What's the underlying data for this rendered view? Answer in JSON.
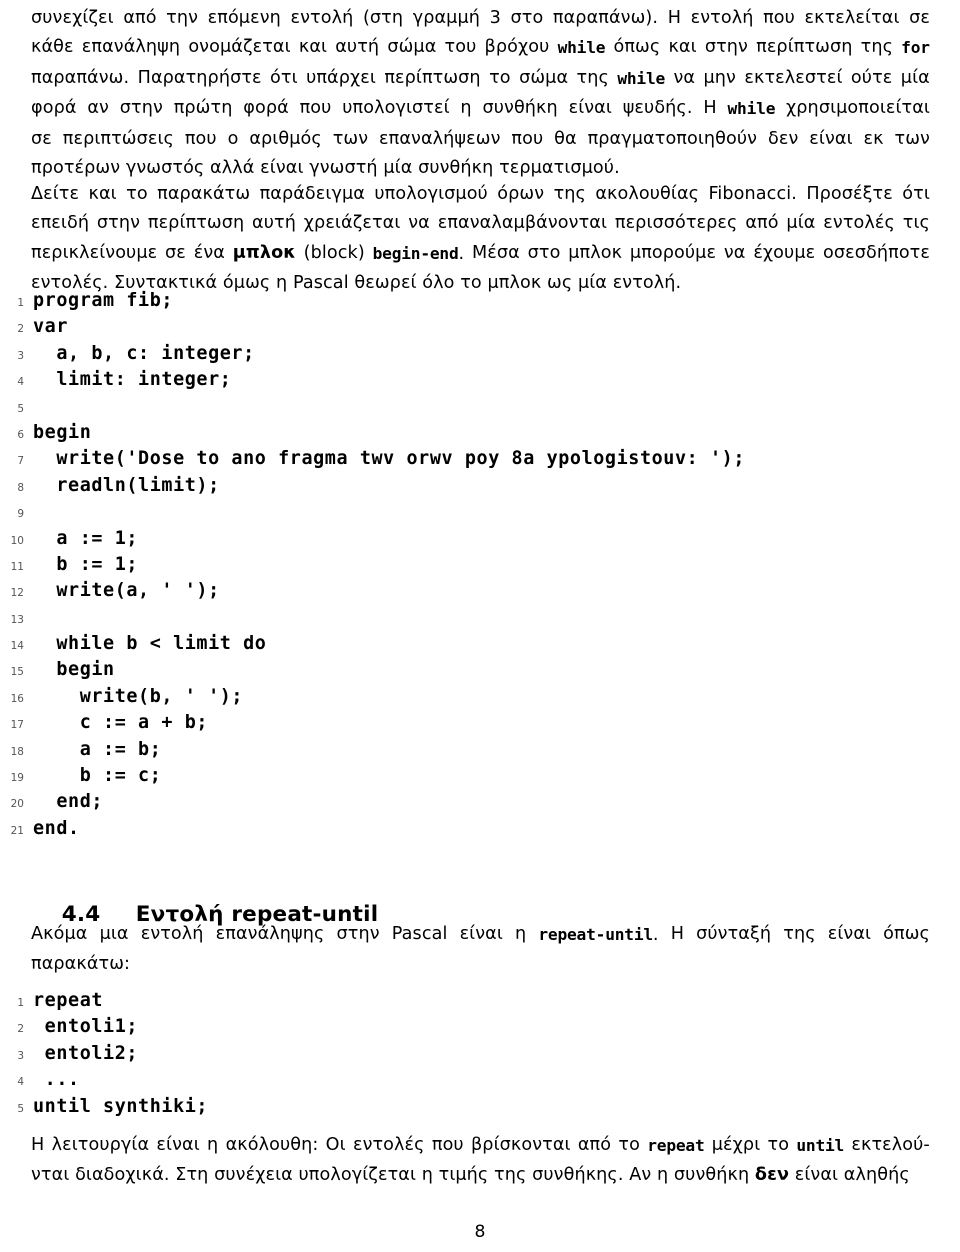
{
  "document": {
    "page_number": "8",
    "language": "el"
  },
  "paragraphs": {
    "p1": {
      "lines": [
        [
          "συνεχίζει από την επόμενη εντολή (στη γραμμή 3 στο παραπάνω). Η εντολή που εκτελείται σε"
        ],
        [
          "κάθε επανάληψη ονομάζεται και αυτή σώμα του βρόχου ",
          "while",
          " όπως και στην περίπτωση της ",
          "for"
        ],
        [
          "παραπάνω. Παρατηρήστε ότι υπάρχει περίπτωση το σώμα της ",
          "while",
          " να μην εκτελεστεί ούτε μία"
        ],
        [
          "φορά αν στην πρώτη φορά που υπολογιστεί η συνθήκη είναι ψευδής. Η ",
          "while",
          " χρησιμοποιείται"
        ],
        [
          "σε περιπτώσεις που ο αριθμός των επαναλήψεων που θα πραγματοποιηθούν δεν είναι εκ των"
        ],
        [
          "προτέρων γνωστός αλλά είναι γνωστή μία συνθήκη τερματισμού."
        ]
      ]
    },
    "p2": {
      "lines": [
        [
          "Δείτε και το παρακάτω παράδειγμα υπολογισμού όρων της ακολουθίας Fibonacci. Προσέξτε ότι"
        ],
        [
          "επειδή στην περίπτωση αυτή χρειάζεται να επαναλαμβάνονται περισσότερες από μία εντολές τις"
        ],
        [
          "περικλείνουμε σε ένα ",
          "μπλοκ",
          " (block) ",
          "begin-end",
          ". Μέσα στο μπλοκ μπορούμε να έχουμε οσεσδήποτε"
        ],
        [
          "εντολές. Συντακτικά όμως η Pascal θεωρεί όλο το μπλοκ ως μία εντολή."
        ]
      ]
    },
    "p3": {
      "lines": [
        [
          "Ακόμα μια εντολή επανάληψης στην Pascal είναι η ",
          "repeat-until",
          ". Η σύνταξή της είναι όπως"
        ],
        [
          "παρακάτω:"
        ]
      ]
    },
    "p4": {
      "lines": [
        [
          "Η λειτουργία είναι η ακόλουθη: Οι εντολές που βρίσκονται από το ",
          "repeat",
          " μέχρι το ",
          "until",
          " εκτελού-"
        ],
        [
          "νται διαδοχικά. Στη συνέχεια υπολογίζεται η τιμής της συνθήκης. Αν η συνθήκη ",
          "δεν",
          " είναι αληθής"
        ]
      ]
    }
  },
  "heading": {
    "number": "4.4",
    "text": "Εντολή repeat-until"
  },
  "listing_fib": {
    "lines": [
      {
        "n": "1",
        "code": "program fib;"
      },
      {
        "n": "2",
        "code": "var"
      },
      {
        "n": "3",
        "code": "  a, b, c: integer;"
      },
      {
        "n": "4",
        "code": "  limit: integer;"
      },
      {
        "n": "5",
        "code": ""
      },
      {
        "n": "6",
        "code": "begin"
      },
      {
        "n": "7",
        "code": "  write('Dose to ano fragma twv orwv poy 8a ypologistouv: ');"
      },
      {
        "n": "8",
        "code": "  readln(limit);"
      },
      {
        "n": "9",
        "code": ""
      },
      {
        "n": "10",
        "code": "  a := 1;"
      },
      {
        "n": "11",
        "code": "  b := 1;"
      },
      {
        "n": "12",
        "code": "  write(a, ' ');"
      },
      {
        "n": "13",
        "code": ""
      },
      {
        "n": "14",
        "code": "  while b < limit do"
      },
      {
        "n": "15",
        "code": "  begin"
      },
      {
        "n": "16",
        "code": "    write(b, ' ');"
      },
      {
        "n": "17",
        "code": "    c := a + b;"
      },
      {
        "n": "18",
        "code": "    a := b;"
      },
      {
        "n": "19",
        "code": "    b := c;"
      },
      {
        "n": "20",
        "code": "  end;"
      },
      {
        "n": "21",
        "code": "end."
      }
    ]
  },
  "listing_repeat": {
    "lines": [
      {
        "n": "1",
        "code": "repeat"
      },
      {
        "n": "2",
        "code": " entoli1;"
      },
      {
        "n": "3",
        "code": " entoli2;"
      },
      {
        "n": "4",
        "code": " ..."
      },
      {
        "n": "5",
        "code": "until synthiki;"
      }
    ]
  }
}
